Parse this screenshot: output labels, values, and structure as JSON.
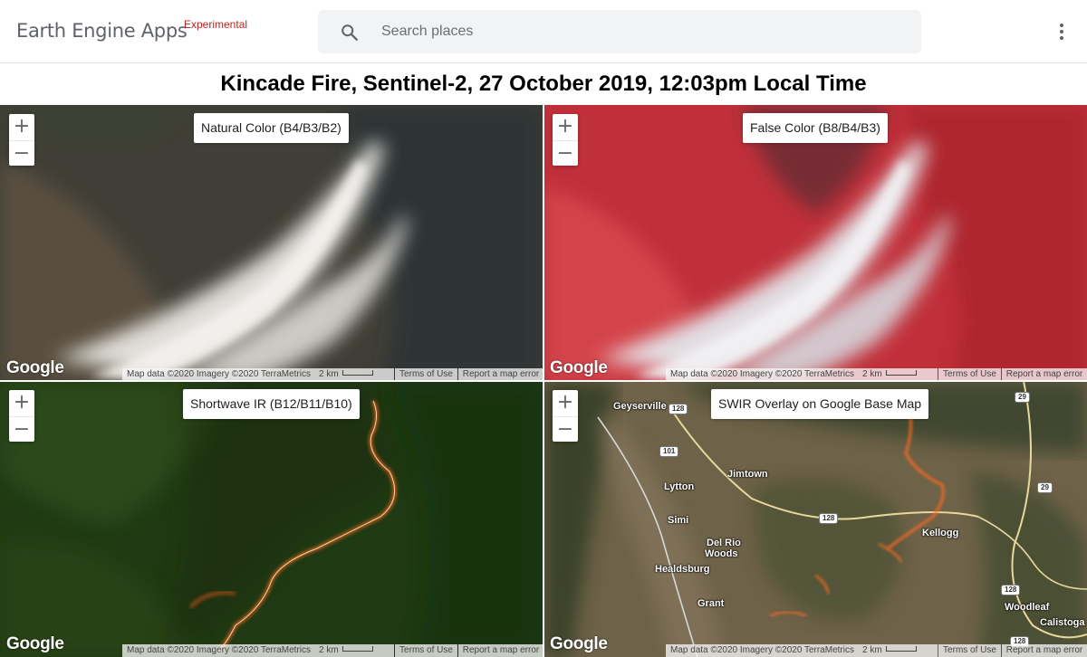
{
  "header": {
    "brand": "Earth Engine Apps",
    "brand_tag": "Experimental",
    "search_placeholder": "Search places",
    "search_icon": "search-icon",
    "menu_icon": "more-vert-icon"
  },
  "page_title": "Kincade Fire, Sentinel-2, 27 October 2019, 12:03pm Local Time",
  "panels": [
    {
      "label": "Natural Color (B4/B3/B2)",
      "zoom_in": "+",
      "zoom_out": "−",
      "logo": "Google",
      "attribution": "Map data ©2020 Imagery ©2020 TerraMetrics",
      "scale": "2 km",
      "terms": "Terms of Use",
      "report": "Report a map error"
    },
    {
      "label": "False Color (B8/B4/B3)",
      "zoom_in": "+",
      "zoom_out": "−",
      "logo": "Google",
      "attribution": "Map data ©2020 Imagery ©2020 TerraMetrics",
      "scale": "2 km",
      "terms": "Terms of Use",
      "report": "Report a map error"
    },
    {
      "label": "Shortwave IR (B12/B11/B10)",
      "zoom_in": "+",
      "zoom_out": "−",
      "logo": "Google",
      "attribution": "Map data ©2020 Imagery ©2020 TerraMetrics",
      "scale": "2 km",
      "terms": "Terms of Use",
      "report": "Report a map error"
    },
    {
      "label": "SWIR Overlay on Google Base Map",
      "zoom_in": "+",
      "zoom_out": "−",
      "logo": "Google",
      "attribution": "Map data ©2020 Imagery ©2020 TerraMetrics",
      "scale": "2 km",
      "terms": "Terms of Use",
      "report": "Report a map error",
      "places": [
        "Geyserville",
        "Jimtown",
        "Lytton",
        "Simi",
        "Del Rio",
        "Woods",
        "Healdsburg",
        "Grant",
        "Kellogg",
        "Woodleaf",
        "Calistoga"
      ],
      "road_shields": [
        "128",
        "101",
        "128",
        "128",
        "29",
        "29",
        "128"
      ]
    }
  ],
  "colors": {
    "experimental_tag": "#c5221f",
    "search_bg": "#f1f3f4",
    "fire_front": "#ff5a1e"
  }
}
